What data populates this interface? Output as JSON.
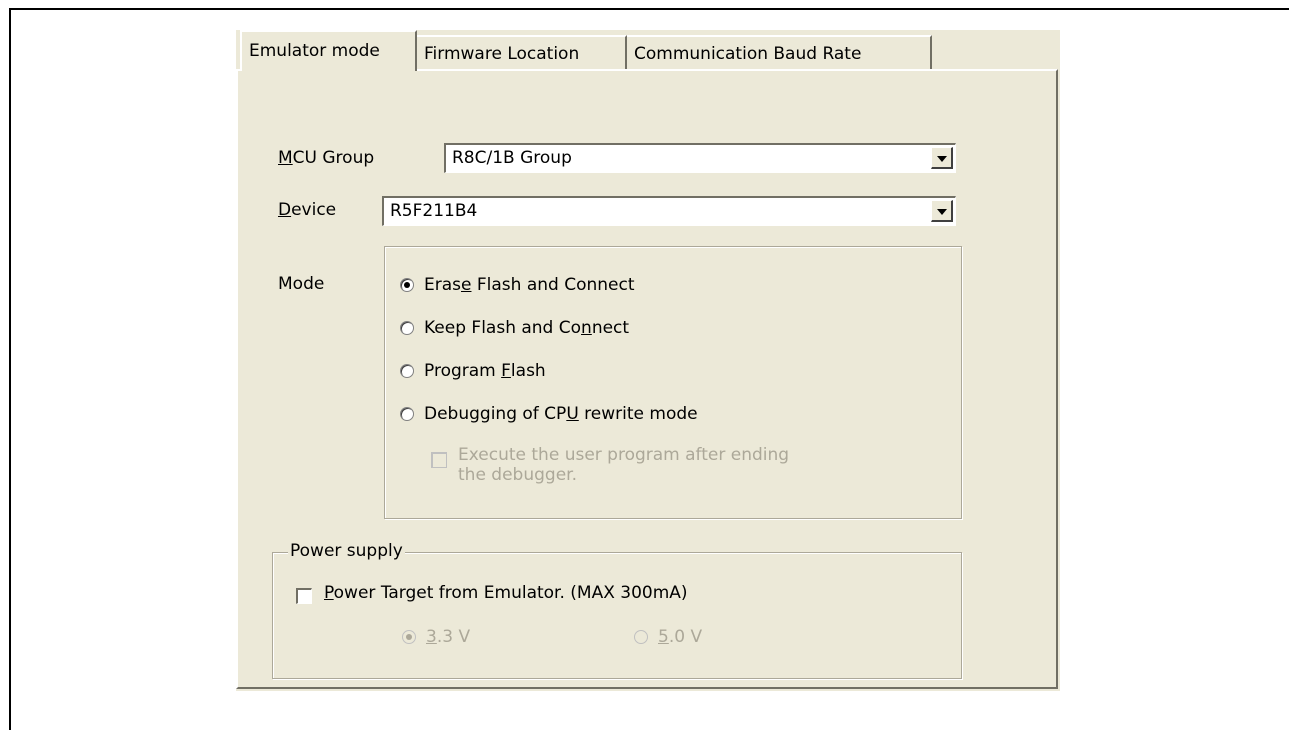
{
  "tabs": [
    {
      "label": "Emulator mode",
      "active": true
    },
    {
      "label": "Firmware Location",
      "active": false
    },
    {
      "label": "Communication Baud Rate",
      "active": false
    }
  ],
  "mcu_group": {
    "label_accel": "M",
    "label_rest": "CU Group",
    "value": "R8C/1B Group"
  },
  "device": {
    "label_accel": "D",
    "label_rest": "evice",
    "value": "R5F211B4"
  },
  "mode": {
    "label": "Mode",
    "options": [
      {
        "pre": "Eras",
        "accel": "e",
        "post": " Flash and Connect",
        "selected": true
      },
      {
        "pre": "Keep Flash and Co",
        "accel": "n",
        "post": "nect",
        "selected": false
      },
      {
        "pre": "Program ",
        "accel": "F",
        "post": "lash",
        "selected": false
      },
      {
        "pre": "Debugging of CP",
        "accel": "U",
        "post": " rewrite mode",
        "selected": false
      }
    ],
    "execute_checkbox": {
      "line1": "Execute the user program after ending",
      "line2": "the debugger.",
      "checked": false,
      "enabled": false
    }
  },
  "power_supply": {
    "legend": "Power supply",
    "checkbox": {
      "accel": "P",
      "rest": "ower Target from Emulator. (MAX 300mA)",
      "checked": false
    },
    "voltages": [
      {
        "accel": "3",
        "rest": ".3 V",
        "selected": true,
        "enabled": false
      },
      {
        "accel": "5",
        "rest": ".0 V",
        "selected": false,
        "enabled": false
      }
    ]
  }
}
